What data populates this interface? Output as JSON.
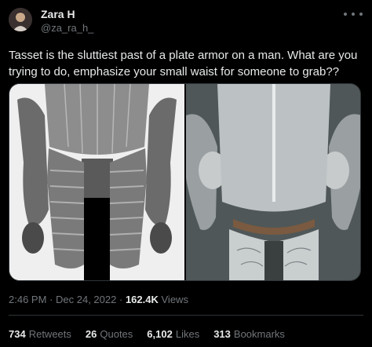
{
  "author": {
    "name": "Zara H",
    "handle": "@za_ra_h_"
  },
  "tweet": {
    "text": "Tasset is the sluttiest past of a plate armor on a man. What are you trying to do, emphasize your small waist for someone to grab??"
  },
  "meta": {
    "time": "2:46 PM",
    "separator": "·",
    "date": "Dec 24, 2022",
    "views_count": "162.4K",
    "views_label": "Views"
  },
  "stats": {
    "retweets_count": "734",
    "retweets_label": "Retweets",
    "quotes_count": "26",
    "quotes_label": "Quotes",
    "likes_count": "6,102",
    "likes_label": "Likes",
    "bookmarks_count": "313",
    "bookmarks_label": "Bookmarks"
  },
  "icons": {
    "more": "more-icon"
  },
  "colors": {
    "background": "#000000",
    "text_primary": "#e7e9ea",
    "text_secondary": "#71767b",
    "divider": "#2f3336"
  }
}
